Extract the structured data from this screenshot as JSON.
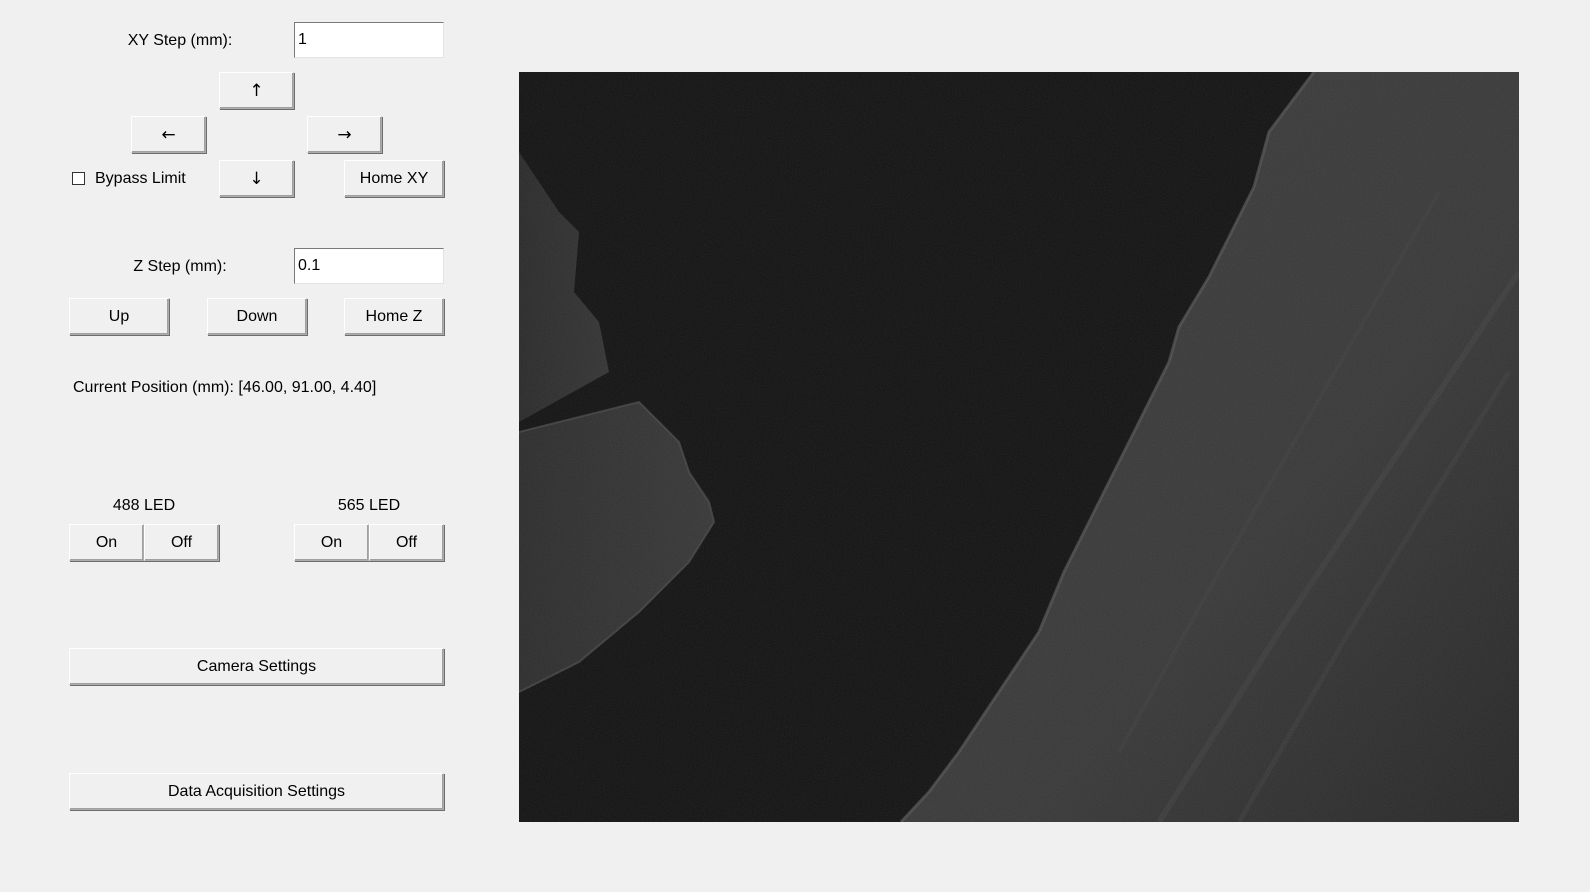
{
  "xy": {
    "step_label": "XY Step (mm):",
    "step_value": "1",
    "up_glyph": "↑",
    "left_glyph": "←",
    "right_glyph": "→",
    "down_glyph": "↓",
    "bypass_label": "Bypass Limit",
    "bypass_checked": false,
    "home_label": "Home XY"
  },
  "z": {
    "step_label": "Z Step (mm):",
    "step_value": "0.1",
    "up_label": "Up",
    "down_label": "Down",
    "home_label": "Home Z"
  },
  "position": {
    "text": "Current Position (mm): [46.00, 91.00, 4.40]"
  },
  "led488": {
    "title": "488 LED",
    "on_label": "On",
    "off_label": "Off"
  },
  "led565": {
    "title": "565 LED",
    "on_label": "On",
    "off_label": "Off"
  },
  "buttons": {
    "camera_settings": "Camera Settings",
    "data_acquisition_settings": "Data Acquisition Settings"
  },
  "colors": {
    "window_bg": "#f0f0f0",
    "image_background": "#111111",
    "tissue": "#3a3a3a"
  }
}
